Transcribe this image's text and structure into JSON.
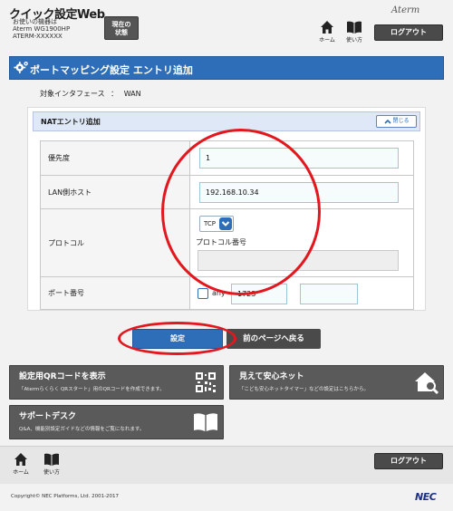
{
  "header": {
    "app_title": "クイック設定Web",
    "device_lines": [
      "お使いの機器は",
      "Aterm WG1900HP",
      "ATERM-XXXXXX"
    ],
    "status_button": [
      "現在の",
      "状態"
    ],
    "brand": "Aterm",
    "home_label": "ホーム",
    "help_label": "使い方",
    "logout_label": "ログアウト"
  },
  "page": {
    "title": "ポートマッピング設定 エントリ追加",
    "interface_label": "対象インタフェース",
    "interface_sep": "：",
    "interface_value": "WAN"
  },
  "nat": {
    "section_title": "NATエントリ追加",
    "close_label": "閉じる",
    "priority": {
      "label": "優先度",
      "value": "1"
    },
    "lan_host": {
      "label": "LAN側ホスト",
      "value": "192.168.10.34"
    },
    "protocol": {
      "label": "プロトコル",
      "selected": "TCP",
      "number_label": "プロトコル番号",
      "number_value": ""
    },
    "port": {
      "label": "ポート番号",
      "any_label": "any",
      "any_checked": false,
      "start_value": "1723",
      "end_value": ""
    }
  },
  "actions": {
    "set_label": "設定",
    "back_label": "前のページへ戻る"
  },
  "cards": {
    "qr": {
      "title": "設定用QRコードを表示",
      "desc": "「Atermらくらく QRスタート」用のQRコードを作成できます。"
    },
    "safenet": {
      "title": "見えて安心ネット",
      "desc": "「こども安心ネットタイマー」などの設定はこちらから。"
    },
    "support": {
      "title": "サポートデスク",
      "desc": "Q&A、機能別設定ガイドなどの情報をご覧になれます。"
    }
  },
  "footer": {
    "home_label": "ホーム",
    "help_label": "使い方",
    "logout_label": "ログアウト",
    "copyright": "Copyright© NEC Platforms, Ltd. 2001-2017",
    "nec_logo": "NEC"
  },
  "colors": {
    "accent_blue": "#2e6eb8",
    "annotation_red": "#e3171e",
    "dark_button": "#4a4a4a"
  }
}
